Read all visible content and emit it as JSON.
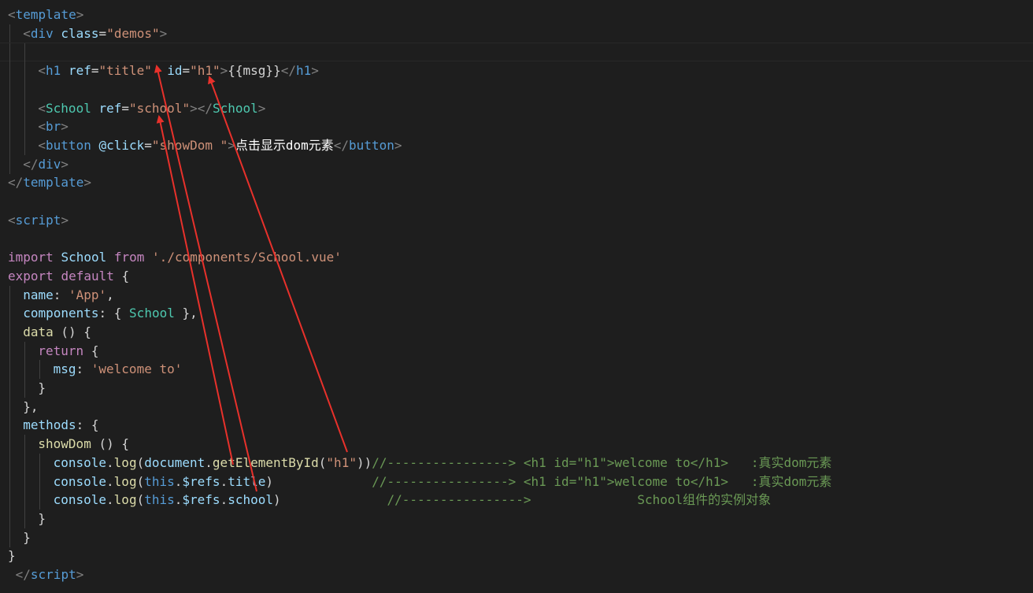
{
  "editor": {
    "language": "vue",
    "lines": [
      {
        "indent": 0,
        "tokens": [
          [
            "p",
            "<"
          ],
          [
            "t",
            "template"
          ],
          [
            "p",
            ">"
          ]
        ]
      },
      {
        "indent": 1,
        "tokens": [
          [
            "p",
            "<"
          ],
          [
            "t",
            "div"
          ],
          [
            "d",
            " "
          ],
          [
            "a",
            "class"
          ],
          [
            "d",
            "="
          ],
          [
            "s",
            "\"demos\""
          ],
          [
            "p",
            ">"
          ]
        ]
      },
      {
        "indent": 2,
        "tokens": [],
        "current": true
      },
      {
        "indent": 2,
        "tokens": [
          [
            "p",
            "<"
          ],
          [
            "t",
            "h1"
          ],
          [
            "d",
            " "
          ],
          [
            "a",
            "ref"
          ],
          [
            "d",
            "="
          ],
          [
            "s",
            "\"title\""
          ],
          [
            "d",
            "  "
          ],
          [
            "a",
            "id"
          ],
          [
            "d",
            "="
          ],
          [
            "s",
            "\"h1\""
          ],
          [
            "p",
            ">"
          ],
          [
            "d",
            "{{msg}}"
          ],
          [
            "p",
            "</"
          ],
          [
            "t",
            "h1"
          ],
          [
            "p",
            ">"
          ]
        ]
      },
      {
        "indent": 2,
        "tokens": []
      },
      {
        "indent": 2,
        "tokens": [
          [
            "p",
            "<"
          ],
          [
            "c",
            "School"
          ],
          [
            "d",
            " "
          ],
          [
            "a",
            "ref"
          ],
          [
            "d",
            "="
          ],
          [
            "s",
            "\"school\""
          ],
          [
            "p",
            "></"
          ],
          [
            "c",
            "School"
          ],
          [
            "p",
            ">"
          ]
        ]
      },
      {
        "indent": 2,
        "tokens": [
          [
            "p",
            "<"
          ],
          [
            "t",
            "br"
          ],
          [
            "p",
            ">"
          ]
        ]
      },
      {
        "indent": 2,
        "tokens": [
          [
            "p",
            "<"
          ],
          [
            "t",
            "button"
          ],
          [
            "d",
            " "
          ],
          [
            "a",
            "@click"
          ],
          [
            "d",
            "="
          ],
          [
            "s",
            "\"showDom \""
          ],
          [
            "p",
            ">"
          ],
          [
            "w",
            "点击显示dom元素"
          ],
          [
            "p",
            "</"
          ],
          [
            "t",
            "button"
          ],
          [
            "p",
            ">"
          ]
        ]
      },
      {
        "indent": 1,
        "tokens": [
          [
            "p",
            "</"
          ],
          [
            "t",
            "div"
          ],
          [
            "p",
            ">"
          ]
        ]
      },
      {
        "indent": 0,
        "tokens": [
          [
            "p",
            "</"
          ],
          [
            "t",
            "template"
          ],
          [
            "p",
            ">"
          ]
        ]
      },
      {
        "indent": 0,
        "tokens": []
      },
      {
        "indent": 0,
        "tokens": [
          [
            "p",
            "<"
          ],
          [
            "t",
            "script"
          ],
          [
            "p",
            ">"
          ]
        ]
      },
      {
        "indent": 0,
        "tokens": []
      },
      {
        "indent": 0,
        "tokens": [
          [
            "k",
            "import"
          ],
          [
            "d",
            " "
          ],
          [
            "a",
            "School"
          ],
          [
            "d",
            " "
          ],
          [
            "k",
            "from"
          ],
          [
            "d",
            " "
          ],
          [
            "s",
            "'./components/School.vue'"
          ]
        ]
      },
      {
        "indent": 0,
        "tokens": [
          [
            "k",
            "export"
          ],
          [
            "d",
            " "
          ],
          [
            "k",
            "default"
          ],
          [
            "d",
            " {"
          ]
        ]
      },
      {
        "indent": 1,
        "tokens": [
          [
            "a",
            "name"
          ],
          [
            "d",
            ": "
          ],
          [
            "s",
            "'App'"
          ],
          [
            "d",
            ","
          ]
        ]
      },
      {
        "indent": 1,
        "tokens": [
          [
            "a",
            "components"
          ],
          [
            "d",
            ": { "
          ],
          [
            "c",
            "School"
          ],
          [
            "d",
            " },"
          ]
        ]
      },
      {
        "indent": 1,
        "tokens": [
          [
            "f",
            "data"
          ],
          [
            "d",
            " () {"
          ]
        ]
      },
      {
        "indent": 2,
        "tokens": [
          [
            "k",
            "return"
          ],
          [
            "d",
            " {"
          ]
        ]
      },
      {
        "indent": 3,
        "tokens": [
          [
            "a",
            "msg"
          ],
          [
            "d",
            ": "
          ],
          [
            "s",
            "'welcome to'"
          ]
        ]
      },
      {
        "indent": 2,
        "tokens": [
          [
            "d",
            "}"
          ]
        ]
      },
      {
        "indent": 1,
        "tokens": [
          [
            "d",
            "},"
          ]
        ]
      },
      {
        "indent": 1,
        "tokens": [
          [
            "a",
            "methods"
          ],
          [
            "d",
            ": {"
          ]
        ]
      },
      {
        "indent": 2,
        "tokens": [
          [
            "f",
            "showDom"
          ],
          [
            "d",
            " () {"
          ]
        ]
      },
      {
        "indent": 3,
        "tokens": [
          [
            "a",
            "console"
          ],
          [
            "d",
            "."
          ],
          [
            "f",
            "log"
          ],
          [
            "d",
            "("
          ],
          [
            "a",
            "document"
          ],
          [
            "d",
            "."
          ],
          [
            "f",
            "getElementById"
          ],
          [
            "d",
            "("
          ],
          [
            "s",
            "\"h1\""
          ],
          [
            "d",
            "))"
          ],
          [
            "m",
            "//----------------> <h1 id=\"h1\">welcome to</h1>   :真实dom元素"
          ]
        ]
      },
      {
        "indent": 3,
        "tokens": [
          [
            "a",
            "console"
          ],
          [
            "d",
            "."
          ],
          [
            "f",
            "log"
          ],
          [
            "d",
            "("
          ],
          [
            "t",
            "this"
          ],
          [
            "d",
            "."
          ],
          [
            "a",
            "$refs"
          ],
          [
            "d",
            "."
          ],
          [
            "a",
            "title"
          ],
          [
            "d",
            ")             "
          ],
          [
            "m",
            "//----------------> <h1 id=\"h1\">welcome to</h1>   :真实dom元素"
          ]
        ]
      },
      {
        "indent": 3,
        "tokens": [
          [
            "a",
            "console"
          ],
          [
            "d",
            "."
          ],
          [
            "f",
            "log"
          ],
          [
            "d",
            "("
          ],
          [
            "t",
            "this"
          ],
          [
            "d",
            "."
          ],
          [
            "a",
            "$refs"
          ],
          [
            "d",
            "."
          ],
          [
            "a",
            "school"
          ],
          [
            "d",
            ")              "
          ],
          [
            "m",
            "//---------------->              School组件的实例对象"
          ]
        ]
      },
      {
        "indent": 2,
        "tokens": [
          [
            "d",
            "}"
          ]
        ]
      },
      {
        "indent": 1,
        "tokens": [
          [
            "d",
            "}"
          ]
        ]
      },
      {
        "indent": 0,
        "tokens": [
          [
            "d",
            "}"
          ]
        ]
      },
      {
        "indent": 0,
        "tokens": [
          [
            "d",
            " "
          ],
          [
            "p",
            "</"
          ],
          [
            "t",
            "script"
          ],
          [
            "p",
            ">"
          ]
        ]
      }
    ]
  },
  "annotations": {
    "arrow_color": "#e8312b"
  }
}
